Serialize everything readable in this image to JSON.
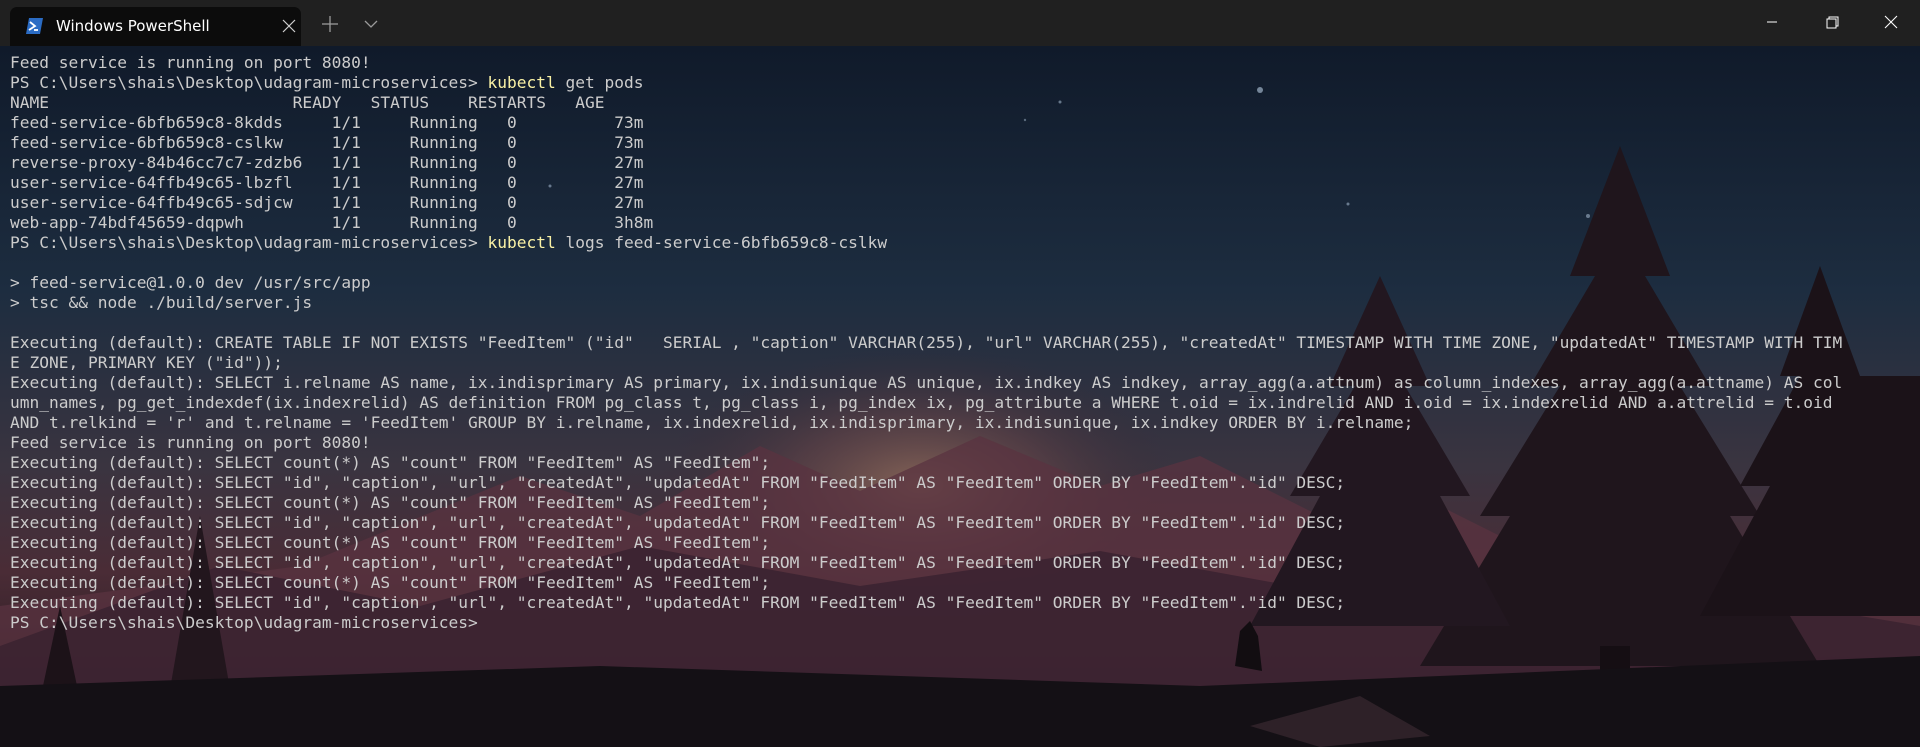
{
  "titlebar": {
    "tab_title": "Windows PowerShell",
    "tab_icon": "powershell-icon",
    "icons": {
      "close_tab": "close-icon",
      "new_tab": "plus-icon",
      "dropdown": "chevron-down-icon",
      "minimize": "minimize-icon",
      "restore": "restore-icon",
      "close_window": "close-icon"
    }
  },
  "colors": {
    "titlebar_bg": "#202020",
    "tab_bg": "#0c0c0c",
    "terminal_text": "#cccccc",
    "command_highlight": "#f9f1a5"
  },
  "terminal": {
    "lines": [
      {
        "text": "Feed service is running on port 8080!"
      },
      {
        "prompt": "PS C:\\Users\\shais\\Desktop\\udagram-microservices> ",
        "cmd": "kubectl",
        "args": " get pods"
      },
      {
        "text": "NAME                         READY   STATUS    RESTARTS   AGE"
      },
      {
        "text": "feed-service-6bfb659c8-8kdds     1/1     Running   0          73m"
      },
      {
        "text": "feed-service-6bfb659c8-cslkw     1/1     Running   0          73m"
      },
      {
        "text": "reverse-proxy-84b46cc7c7-zdzb6   1/1     Running   0          27m"
      },
      {
        "text": "user-service-64ffb49c65-lbzfl    1/1     Running   0          27m"
      },
      {
        "text": "user-service-64ffb49c65-sdjcw    1/1     Running   0          27m"
      },
      {
        "text": "web-app-74bdf45659-dqpwh         1/1     Running   0          3h8m"
      },
      {
        "prompt": "PS C:\\Users\\shais\\Desktop\\udagram-microservices> ",
        "cmd": "kubectl",
        "args": " logs feed-service-6bfb659c8-cslkw"
      },
      {
        "text": ""
      },
      {
        "text": "> feed-service@1.0.0 dev /usr/src/app"
      },
      {
        "text": "> tsc && node ./build/server.js"
      },
      {
        "text": ""
      },
      {
        "text": "Executing (default): CREATE TABLE IF NOT EXISTS \"FeedItem\" (\"id\"   SERIAL , \"caption\" VARCHAR(255), \"url\" VARCHAR(255), \"createdAt\" TIMESTAMP WITH TIME ZONE, \"updatedAt\" TIMESTAMP WITH TIM"
      },
      {
        "text": "E ZONE, PRIMARY KEY (\"id\"));"
      },
      {
        "text": "Executing (default): SELECT i.relname AS name, ix.indisprimary AS primary, ix.indisunique AS unique, ix.indkey AS indkey, array_agg(a.attnum) as column_indexes, array_agg(a.attname) AS col"
      },
      {
        "text": "umn_names, pg_get_indexdef(ix.indexrelid) AS definition FROM pg_class t, pg_class i, pg_index ix, pg_attribute a WHERE t.oid = ix.indrelid AND i.oid = ix.indexrelid AND a.attrelid = t.oid"
      },
      {
        "text": "AND t.relkind = 'r' and t.relname = 'FeedItem' GROUP BY i.relname, ix.indexrelid, ix.indisprimary, ix.indisunique, ix.indkey ORDER BY i.relname;"
      },
      {
        "text": "Feed service is running on port 8080!"
      },
      {
        "text": "Executing (default): SELECT count(*) AS \"count\" FROM \"FeedItem\" AS \"FeedItem\";"
      },
      {
        "text": "Executing (default): SELECT \"id\", \"caption\", \"url\", \"createdAt\", \"updatedAt\" FROM \"FeedItem\" AS \"FeedItem\" ORDER BY \"FeedItem\".\"id\" DESC;"
      },
      {
        "text": "Executing (default): SELECT count(*) AS \"count\" FROM \"FeedItem\" AS \"FeedItem\";"
      },
      {
        "text": "Executing (default): SELECT \"id\", \"caption\", \"url\", \"createdAt\", \"updatedAt\" FROM \"FeedItem\" AS \"FeedItem\" ORDER BY \"FeedItem\".\"id\" DESC;"
      },
      {
        "text": "Executing (default): SELECT count(*) AS \"count\" FROM \"FeedItem\" AS \"FeedItem\";"
      },
      {
        "text": "Executing (default): SELECT \"id\", \"caption\", \"url\", \"createdAt\", \"updatedAt\" FROM \"FeedItem\" AS \"FeedItem\" ORDER BY \"FeedItem\".\"id\" DESC;"
      },
      {
        "text": "Executing (default): SELECT count(*) AS \"count\" FROM \"FeedItem\" AS \"FeedItem\";"
      },
      {
        "text": "Executing (default): SELECT \"id\", \"caption\", \"url\", \"createdAt\", \"updatedAt\" FROM \"FeedItem\" AS \"FeedItem\" ORDER BY \"FeedItem\".\"id\" DESC;"
      },
      {
        "prompt": "PS C:\\Users\\shais\\Desktop\\udagram-microservices> ",
        "cmd": "",
        "args": ""
      }
    ]
  }
}
